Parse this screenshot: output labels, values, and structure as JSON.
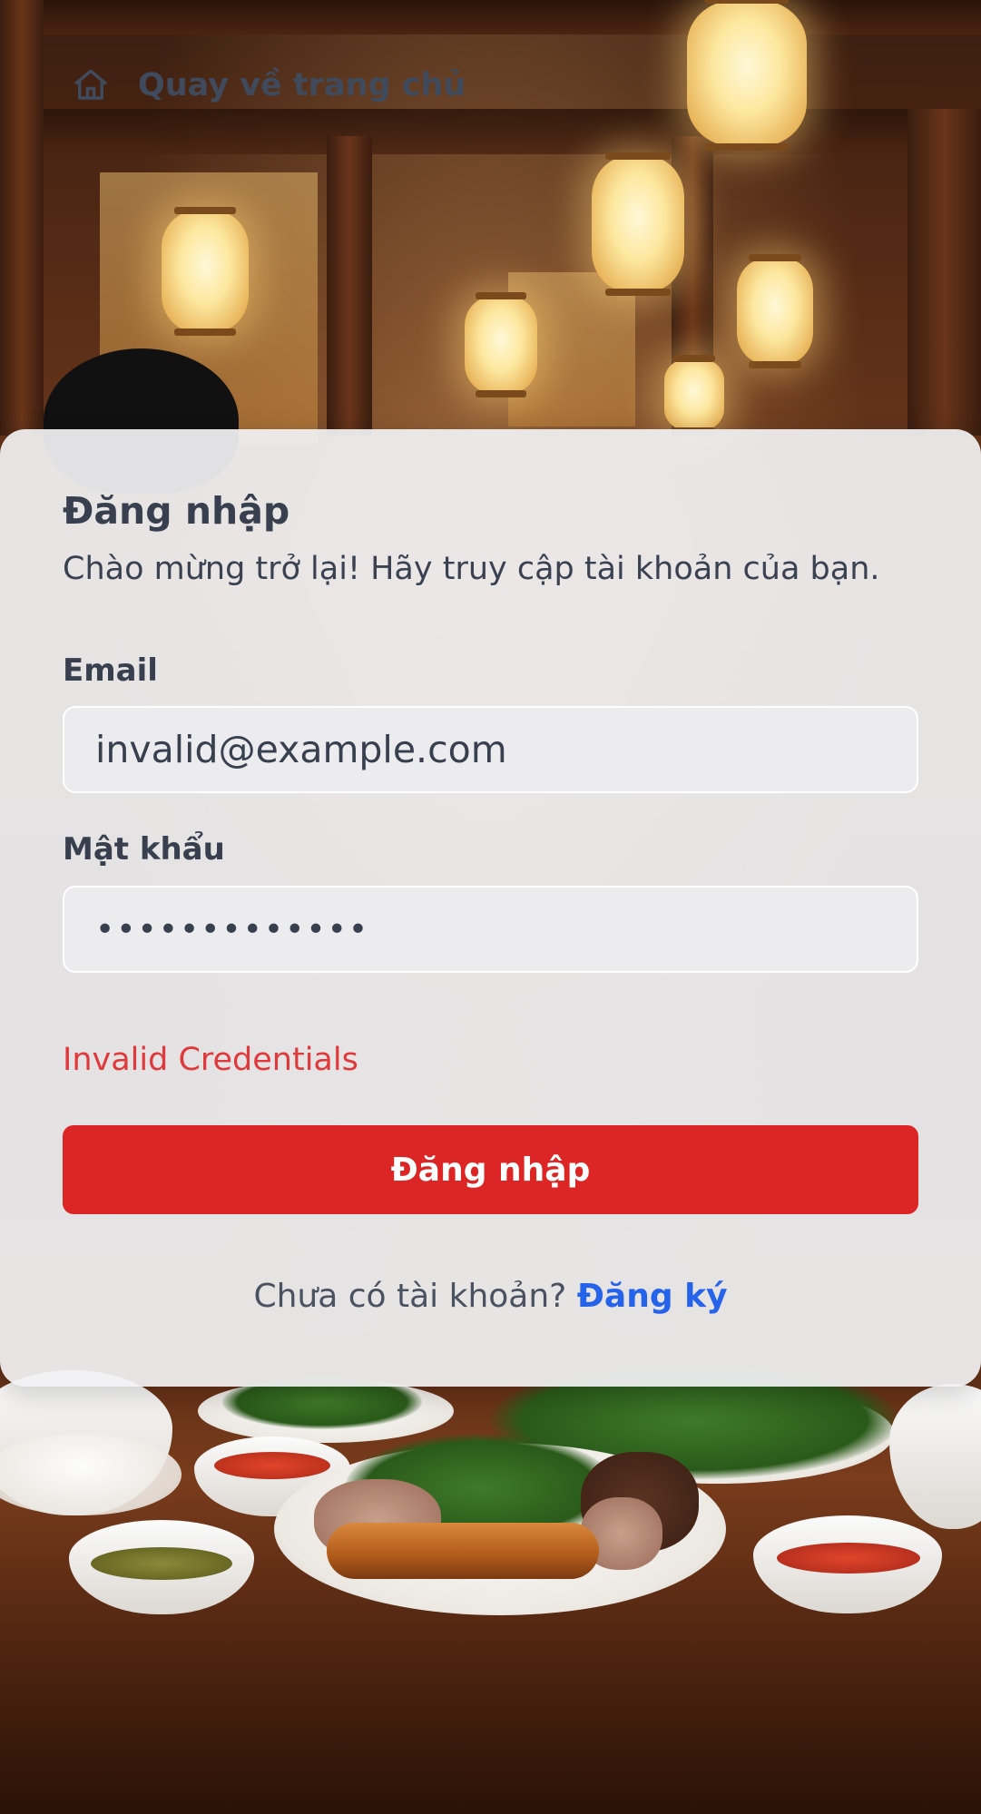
{
  "nav": {
    "back_home_label": "Quay về trang chủ",
    "icon": "home-icon"
  },
  "login": {
    "title": "Đăng nhập",
    "subtitle": "Chào mừng trở lại! Hãy truy cập tài khoản của bạn.",
    "email_label": "Email",
    "email_value": "invalid@example.com",
    "password_label": "Mật khẩu",
    "password_value": "•••••••••••••",
    "error_message": "Invalid Credentials",
    "submit_label": "Đăng nhập",
    "no_account_text": "Chưa có tài khoản?",
    "register_link": "Đăng ký"
  },
  "colors": {
    "primary_button": "#dc2626",
    "error_text": "#e0393b",
    "link": "#2563eb"
  }
}
